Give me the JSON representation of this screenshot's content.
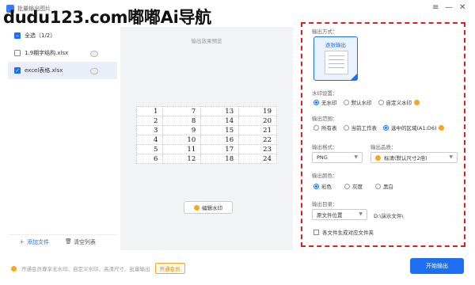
{
  "window": {
    "title": "批量输出图片",
    "watermark": "dudu123.com嘟嘟Ai导航",
    "controls": [
      "≡",
      "—",
      "✕"
    ]
  },
  "file_list": {
    "select_all_label": "全选（1/2）",
    "items": [
      {
        "name": "1.9期字结构.xlsx",
        "checked": false
      },
      {
        "name": "excel表格.xlsx",
        "checked": true
      }
    ],
    "add_file_label": "添加文件",
    "clear_label": "清空列表"
  },
  "preview": {
    "title": "输出效果预览",
    "table": [
      [
        "1",
        "7",
        "13",
        "19"
      ],
      [
        "2",
        "8",
        "14",
        "20"
      ],
      [
        "3",
        "9",
        "15",
        "21"
      ],
      [
        "4",
        "10",
        "16",
        "22"
      ],
      [
        "5",
        "11",
        "17",
        "23"
      ],
      [
        "6",
        "12",
        "18",
        "24"
      ]
    ],
    "edit_watermark_label": "编辑水印"
  },
  "settings": {
    "output_mode_label": "输出方式：",
    "output_mode_value": "逐张输出",
    "watermark_label": "水印设置：",
    "watermark_options": [
      "无水印",
      "默认水印",
      "自定义水印"
    ],
    "watermark_selected": 0,
    "range_label": "输出范围：",
    "range_options": [
      "所有表",
      "当前工作表",
      "选中的区域(A1:D6)"
    ],
    "range_selected": 2,
    "format_label": "输出格式：",
    "format_value": "PNG",
    "quality_label": "输出品质：",
    "quality_value": "标清(默认尺寸2倍)",
    "color_label": "输出颜色：",
    "color_options": [
      "彩色",
      "灰度",
      "黑白"
    ],
    "color_selected": 0,
    "dir_label": "输出目录：",
    "dir_value": "原文件位置",
    "dir_path": "D:\\演示文件\\",
    "folder_checkbox_label": "各文件生成对应文件夹"
  },
  "footer": {
    "note": "开通会员尊享无水印、自定义水印、高清尺寸、批量输出",
    "vip_label": "开通会员",
    "start_label": "开始输出"
  },
  "colors": {
    "accent": "#1d6ff2",
    "highlight_border": "#e01e1e",
    "vip": "#f5a623"
  }
}
